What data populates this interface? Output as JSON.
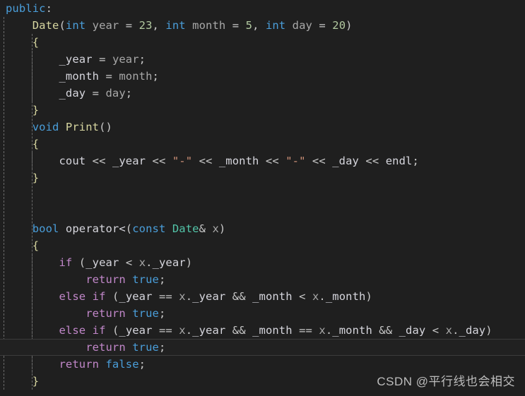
{
  "editor": {
    "background_color": "#1f1f1f",
    "active_line_background": "#212121",
    "active_line_border_color": "#3c3c3c",
    "font_size_px": 15.5,
    "line_height_px": 24,
    "active_line_index": 20,
    "indent_guides_x": [
      5,
      45,
      85,
      125
    ],
    "language": "C++",
    "colors": {
      "keyword": "#4a9eda",
      "control": "#c187c9",
      "function": "#d7d6a0",
      "type": "#52c4a8",
      "number": "#b2c9a0",
      "string": "#ce9178",
      "identifier": "#d6d6dd",
      "parameter": "#a8a8a8",
      "punctuation": "#c8c8c8",
      "brace": "#d7d6a0"
    }
  },
  "watermark": {
    "text": "CSDN @平行线也会相交"
  },
  "code": {
    "plain_text": "public:\n    Date(int year = 23, int month = 5, int day = 20)\n    {\n        _year = year;\n        _month = month;\n        _day = day;\n    }\n    void Print()\n    {\n        cout << \"-\" << _month << \"-\" << _day << endl;\n    }\n\n\n    bool operator<(const Date& x)\n    {\n        if (_year < x._year)\n            return true;\n        else if (_year == x._year && _month < x._month)\n            return true;\n        else if (_year == x._year && _month == x._month && _day < x._day)\n            return true;\n        return false;\n    }",
    "lines": [
      {
        "index": 0,
        "active": false,
        "tokens": [
          {
            "t": "public",
            "c": "kw"
          },
          {
            "t": ":",
            "c": "punc"
          }
        ]
      },
      {
        "index": 1,
        "active": false,
        "tokens": [
          {
            "t": "    ",
            "c": "punc"
          },
          {
            "t": "Date",
            "c": "fn"
          },
          {
            "t": "(",
            "c": "punc"
          },
          {
            "t": "int",
            "c": "kw"
          },
          {
            "t": " ",
            "c": "punc"
          },
          {
            "t": "year",
            "c": "dim"
          },
          {
            "t": " = ",
            "c": "punc"
          },
          {
            "t": "23",
            "c": "num"
          },
          {
            "t": ", ",
            "c": "punc"
          },
          {
            "t": "int",
            "c": "kw"
          },
          {
            "t": " ",
            "c": "punc"
          },
          {
            "t": "month",
            "c": "dim"
          },
          {
            "t": " = ",
            "c": "punc"
          },
          {
            "t": "5",
            "c": "num"
          },
          {
            "t": ", ",
            "c": "punc"
          },
          {
            "t": "int",
            "c": "kw"
          },
          {
            "t": " ",
            "c": "punc"
          },
          {
            "t": "day",
            "c": "dim"
          },
          {
            "t": " = ",
            "c": "punc"
          },
          {
            "t": "20",
            "c": "num"
          },
          {
            "t": ")",
            "c": "punc"
          }
        ]
      },
      {
        "index": 2,
        "active": false,
        "tokens": [
          {
            "t": "    ",
            "c": "punc"
          },
          {
            "t": "{",
            "c": "brace"
          }
        ]
      },
      {
        "index": 3,
        "active": false,
        "tokens": [
          {
            "t": "        ",
            "c": "punc"
          },
          {
            "t": "_year",
            "c": "id"
          },
          {
            "t": " = ",
            "c": "punc"
          },
          {
            "t": "year",
            "c": "dim"
          },
          {
            "t": ";",
            "c": "punc"
          }
        ]
      },
      {
        "index": 4,
        "active": false,
        "tokens": [
          {
            "t": "        ",
            "c": "punc"
          },
          {
            "t": "_month",
            "c": "id"
          },
          {
            "t": " = ",
            "c": "punc"
          },
          {
            "t": "month",
            "c": "dim"
          },
          {
            "t": ";",
            "c": "punc"
          }
        ]
      },
      {
        "index": 5,
        "active": false,
        "tokens": [
          {
            "t": "        ",
            "c": "punc"
          },
          {
            "t": "_day",
            "c": "id"
          },
          {
            "t": " = ",
            "c": "punc"
          },
          {
            "t": "day",
            "c": "dim"
          },
          {
            "t": ";",
            "c": "punc"
          }
        ]
      },
      {
        "index": 6,
        "active": false,
        "tokens": [
          {
            "t": "    ",
            "c": "punc"
          },
          {
            "t": "}",
            "c": "brace"
          }
        ]
      },
      {
        "index": 7,
        "active": false,
        "tokens": [
          {
            "t": "    ",
            "c": "punc"
          },
          {
            "t": "void",
            "c": "kw"
          },
          {
            "t": " ",
            "c": "punc"
          },
          {
            "t": "Print",
            "c": "fn"
          },
          {
            "t": "()",
            "c": "punc"
          }
        ]
      },
      {
        "index": 8,
        "active": false,
        "tokens": [
          {
            "t": "    ",
            "c": "punc"
          },
          {
            "t": "{",
            "c": "brace"
          }
        ]
      },
      {
        "index": 9,
        "active": false,
        "tokens": [
          {
            "t": "        ",
            "c": "punc"
          },
          {
            "t": "cout",
            "c": "id"
          },
          {
            "t": " << ",
            "c": "punc"
          },
          {
            "t": "_year",
            "c": "id"
          },
          {
            "t": " << ",
            "c": "punc"
          },
          {
            "t": "\"-\"",
            "c": "str"
          },
          {
            "t": " << ",
            "c": "punc"
          },
          {
            "t": "_month",
            "c": "id"
          },
          {
            "t": " << ",
            "c": "punc"
          },
          {
            "t": "\"-\"",
            "c": "str"
          },
          {
            "t": " << ",
            "c": "punc"
          },
          {
            "t": "_day",
            "c": "id"
          },
          {
            "t": " << ",
            "c": "punc"
          },
          {
            "t": "endl",
            "c": "id"
          },
          {
            "t": ";",
            "c": "punc"
          }
        ]
      },
      {
        "index": 10,
        "active": false,
        "tokens": [
          {
            "t": "    ",
            "c": "punc"
          },
          {
            "t": "}",
            "c": "brace"
          }
        ]
      },
      {
        "index": 11,
        "active": false,
        "tokens": []
      },
      {
        "index": 12,
        "active": false,
        "tokens": []
      },
      {
        "index": 13,
        "active": false,
        "tokens": [
          {
            "t": "    ",
            "c": "punc"
          },
          {
            "t": "bool",
            "c": "kw"
          },
          {
            "t": " ",
            "c": "punc"
          },
          {
            "t": "operator<",
            "c": "id"
          },
          {
            "t": "(",
            "c": "punc"
          },
          {
            "t": "const",
            "c": "kw"
          },
          {
            "t": " ",
            "c": "punc"
          },
          {
            "t": "Date",
            "c": "type"
          },
          {
            "t": "& ",
            "c": "punc"
          },
          {
            "t": "x",
            "c": "dim"
          },
          {
            "t": ")",
            "c": "punc"
          }
        ]
      },
      {
        "index": 14,
        "active": false,
        "tokens": [
          {
            "t": "    ",
            "c": "punc"
          },
          {
            "t": "{",
            "c": "brace"
          }
        ]
      },
      {
        "index": 15,
        "active": false,
        "tokens": [
          {
            "t": "        ",
            "c": "punc"
          },
          {
            "t": "if",
            "c": "ctrl"
          },
          {
            "t": " (",
            "c": "punc"
          },
          {
            "t": "_year",
            "c": "id"
          },
          {
            "t": " < ",
            "c": "punc"
          },
          {
            "t": "x",
            "c": "dim"
          },
          {
            "t": ".",
            "c": "punc"
          },
          {
            "t": "_year",
            "c": "id"
          },
          {
            "t": ")",
            "c": "punc"
          }
        ]
      },
      {
        "index": 16,
        "active": false,
        "tokens": [
          {
            "t": "            ",
            "c": "punc"
          },
          {
            "t": "return",
            "c": "ctrl"
          },
          {
            "t": " ",
            "c": "punc"
          },
          {
            "t": "true",
            "c": "kw"
          },
          {
            "t": ";",
            "c": "punc"
          }
        ]
      },
      {
        "index": 17,
        "active": false,
        "tokens": [
          {
            "t": "        ",
            "c": "punc"
          },
          {
            "t": "else",
            "c": "ctrl"
          },
          {
            "t": " ",
            "c": "punc"
          },
          {
            "t": "if",
            "c": "ctrl"
          },
          {
            "t": " (",
            "c": "punc"
          },
          {
            "t": "_year",
            "c": "id"
          },
          {
            "t": " == ",
            "c": "punc"
          },
          {
            "t": "x",
            "c": "dim"
          },
          {
            "t": ".",
            "c": "punc"
          },
          {
            "t": "_year",
            "c": "id"
          },
          {
            "t": " && ",
            "c": "punc"
          },
          {
            "t": "_month",
            "c": "id"
          },
          {
            "t": " < ",
            "c": "punc"
          },
          {
            "t": "x",
            "c": "dim"
          },
          {
            "t": ".",
            "c": "punc"
          },
          {
            "t": "_month",
            "c": "id"
          },
          {
            "t": ")",
            "c": "punc"
          }
        ]
      },
      {
        "index": 18,
        "active": false,
        "tokens": [
          {
            "t": "            ",
            "c": "punc"
          },
          {
            "t": "return",
            "c": "ctrl"
          },
          {
            "t": " ",
            "c": "punc"
          },
          {
            "t": "true",
            "c": "kw"
          },
          {
            "t": ";",
            "c": "punc"
          }
        ]
      },
      {
        "index": 19,
        "active": false,
        "tokens": [
          {
            "t": "        ",
            "c": "punc"
          },
          {
            "t": "else",
            "c": "ctrl"
          },
          {
            "t": " ",
            "c": "punc"
          },
          {
            "t": "if",
            "c": "ctrl"
          },
          {
            "t": " (",
            "c": "punc"
          },
          {
            "t": "_year",
            "c": "id"
          },
          {
            "t": " == ",
            "c": "punc"
          },
          {
            "t": "x",
            "c": "dim"
          },
          {
            "t": ".",
            "c": "punc"
          },
          {
            "t": "_year",
            "c": "id"
          },
          {
            "t": " && ",
            "c": "punc"
          },
          {
            "t": "_month",
            "c": "id"
          },
          {
            "t": " == ",
            "c": "punc"
          },
          {
            "t": "x",
            "c": "dim"
          },
          {
            "t": ".",
            "c": "punc"
          },
          {
            "t": "_month",
            "c": "id"
          },
          {
            "t": " && ",
            "c": "punc"
          },
          {
            "t": "_day",
            "c": "id"
          },
          {
            "t": " < ",
            "c": "punc"
          },
          {
            "t": "x",
            "c": "dim"
          },
          {
            "t": ".",
            "c": "punc"
          },
          {
            "t": "_day",
            "c": "id"
          },
          {
            "t": ")",
            "c": "punc"
          }
        ]
      },
      {
        "index": 20,
        "active": true,
        "tokens": [
          {
            "t": "            ",
            "c": "punc"
          },
          {
            "t": "return",
            "c": "ctrl"
          },
          {
            "t": " ",
            "c": "punc"
          },
          {
            "t": "true",
            "c": "kw"
          },
          {
            "t": ";",
            "c": "punc"
          }
        ]
      },
      {
        "index": 21,
        "active": false,
        "tokens": [
          {
            "t": "        ",
            "c": "punc"
          },
          {
            "t": "return",
            "c": "ctrl"
          },
          {
            "t": " ",
            "c": "punc"
          },
          {
            "t": "false",
            "c": "kw"
          },
          {
            "t": ";",
            "c": "punc"
          }
        ]
      },
      {
        "index": 22,
        "active": false,
        "tokens": [
          {
            "t": "    ",
            "c": "punc"
          },
          {
            "t": "}",
            "c": "brace"
          }
        ]
      }
    ]
  }
}
